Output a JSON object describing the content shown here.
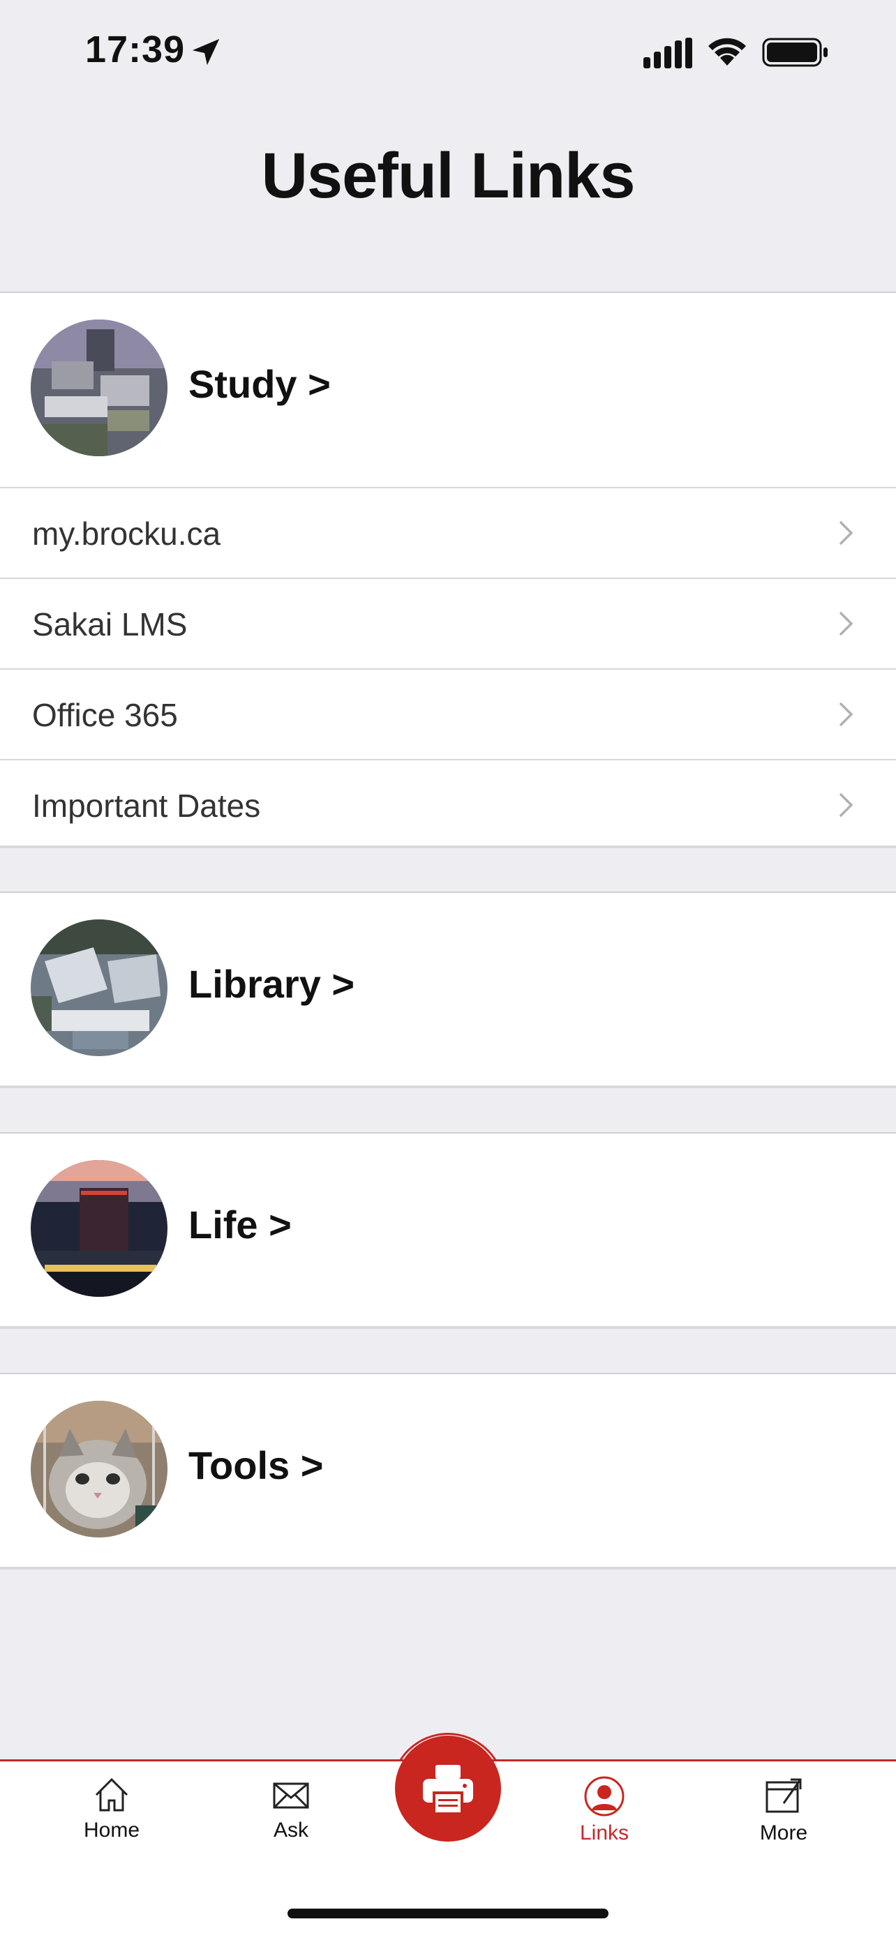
{
  "status_bar": {
    "time": "17:39"
  },
  "page": {
    "title": "Useful Links"
  },
  "sections": [
    {
      "title": "Study >",
      "links": [
        "my.brocku.ca",
        "Sakai LMS",
        "Office 365",
        "Important Dates"
      ]
    },
    {
      "title": "Library >"
    },
    {
      "title": "Life >"
    },
    {
      "title": "Tools >"
    }
  ],
  "tabs": [
    {
      "label": "Home",
      "icon": "home-icon"
    },
    {
      "label": "Ask",
      "icon": "envelope-icon"
    },
    {
      "label": "Links",
      "icon": "person-circle-icon"
    },
    {
      "label": "More",
      "icon": "external-link-icon"
    }
  ],
  "center_button": {
    "icon": "printer-icon"
  },
  "colors": {
    "accent": "#C8261F",
    "background": "#EEEEF2"
  }
}
